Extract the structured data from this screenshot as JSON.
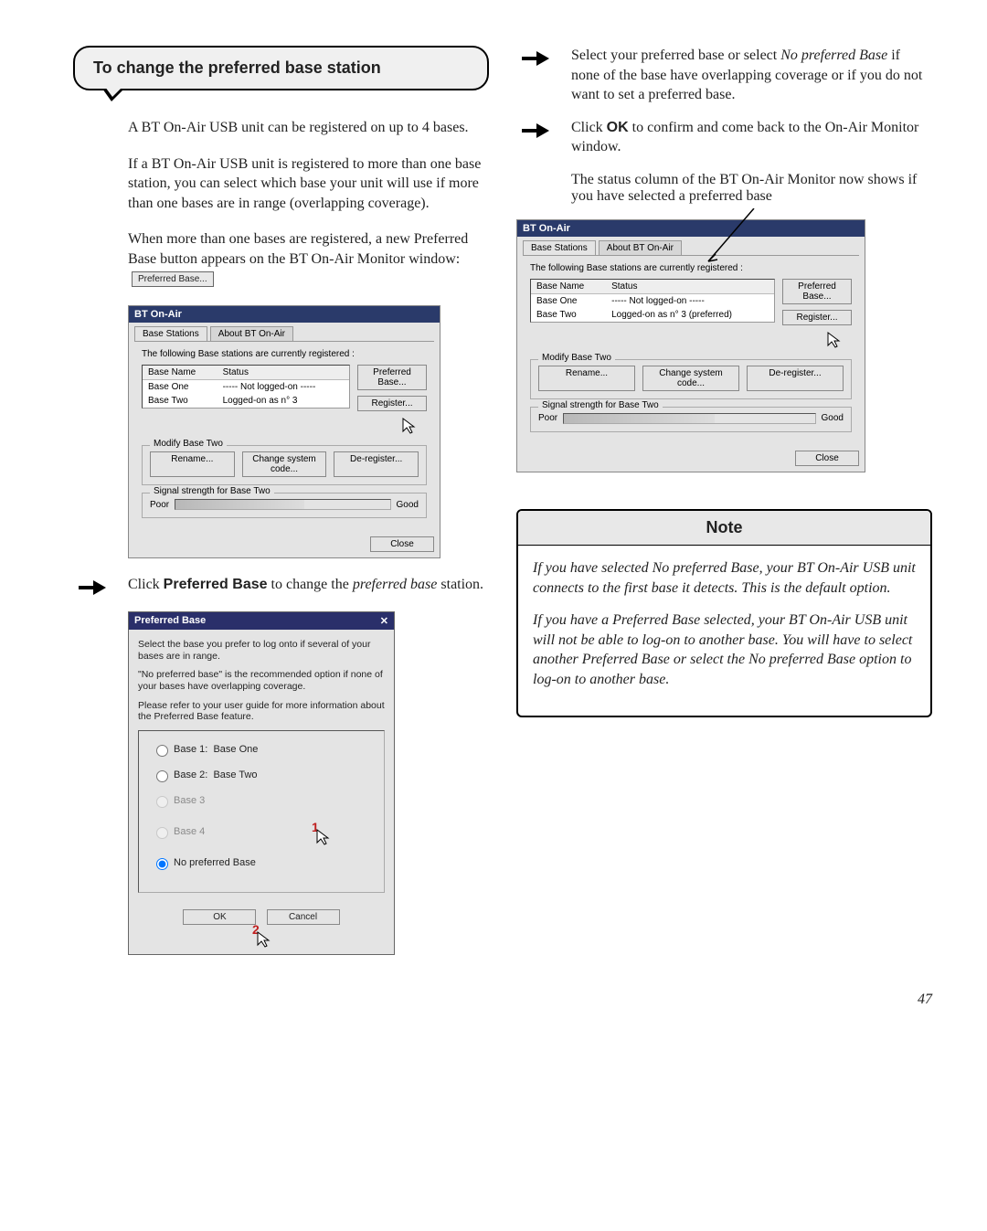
{
  "left": {
    "callout_title": "To change the preferred base station",
    "p1": "A BT On-Air USB unit can be registered on up to 4 bases.",
    "p2": "If a BT On-Air USB unit is registered to more than one base station, you can select which base your unit will use if more than one bases are in range (overlapping coverage).",
    "p3_pre": "When more than one bases are registered, a new Preferred Base button appears on the BT On-Air Monitor window:",
    "inline_btn": "Preferred Base...",
    "step1_pre": "Click ",
    "step1_bold": "Preferred Base",
    "step1_post": " to change the ",
    "step1_italic": "preferred base",
    "step1_tail": " station."
  },
  "right": {
    "step2_pre": "Select your preferred base or select ",
    "step2_italic": "No preferred Base",
    "step2_post": " if none of the base have overlapping coverage or if you do not want to set a preferred base.",
    "step3_pre": "Click ",
    "step3_bold": "OK",
    "step3_post": " to confirm and come back to the On-Air Monitor window.",
    "p_status": "The status column of the BT On-Air Monitor now shows if you have selected a preferred base"
  },
  "win_a": {
    "title": "BT On-Air",
    "tab1": "Base Stations",
    "tab2": "About BT On-Air",
    "intro": "The following Base stations are currently registered :",
    "col_name": "Base Name",
    "col_status": "Status",
    "row1_name": "Base One",
    "row1_status": "----- Not logged-on -----",
    "row2_name": "Base Two",
    "row2_status": "Logged-on as n° 3",
    "btn_pref": "Preferred Base...",
    "btn_reg": "Register...",
    "grp_modify": "Modify Base Two",
    "btn_rename": "Rename...",
    "btn_code": "Change system code...",
    "btn_dereg": "De-register...",
    "grp_signal": "Signal strength for Base Two",
    "poor": "Poor",
    "good": "Good",
    "btn_close": "Close"
  },
  "win_b": {
    "row2_status": "Logged-on as n° 3 (preferred)"
  },
  "dlg": {
    "title": "Preferred Base",
    "p1": "Select the base you prefer to log onto if several of your bases are in range.",
    "p2": "\"No preferred base\" is the recommended option if none of your bases have overlapping coverage.",
    "p3": "Please refer to your user guide for more information about the Preferred Base feature.",
    "opt1_label": "Base 1:",
    "opt1_val": "Base One",
    "opt2_label": "Base 2:",
    "opt2_val": "Base Two",
    "opt3_label": "Base 3",
    "opt4_label": "Base 4",
    "opt5_label": "No preferred Base",
    "ok": "OK",
    "cancel": "Cancel"
  },
  "note": {
    "title": "Note",
    "p1": "If you have selected No preferred Base, your BT On-Air USB unit connects to the first base it detects. This is the default option.",
    "p2": "If you have a Preferred Base selected, your BT On-Air USB unit will not be able to log-on to another base. You will have to select another Preferred Base or select the No preferred Base option to log-on to another base."
  },
  "page_num": "47"
}
